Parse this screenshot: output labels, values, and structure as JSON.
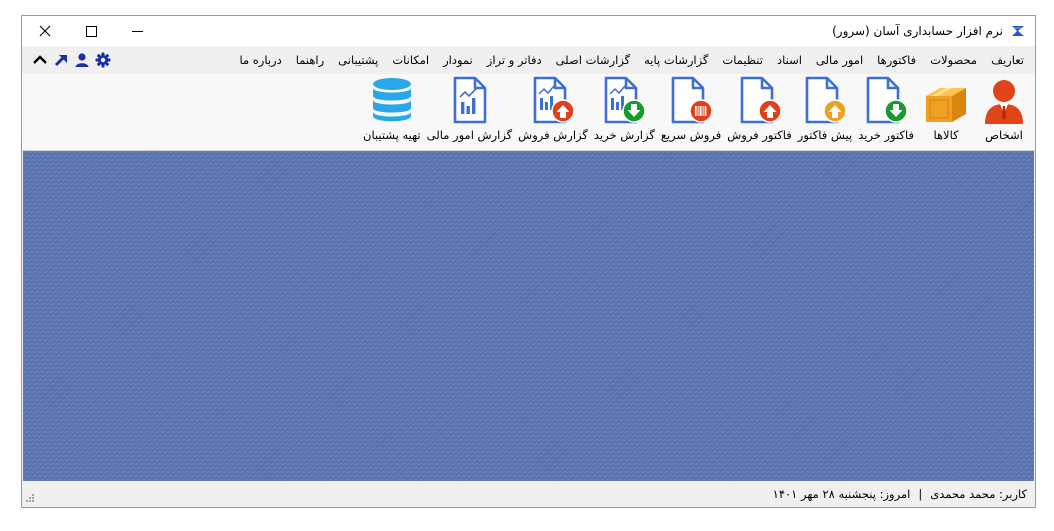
{
  "window": {
    "title": "نرم افزار حسابداری آسان (سرور)",
    "controls": {
      "close": "✕",
      "maximize": "☐",
      "minimize": "—"
    }
  },
  "menu": {
    "items": [
      "تعاریف",
      "محصولات",
      "فاکتورها",
      "امور مالی",
      "اسناد",
      "تنظیمات",
      "گزارشات پایه",
      "گزارشات اصلی",
      "دفاتر و تراز",
      "نمودار",
      "امکانات",
      "پشتیبانی",
      "راهنما",
      "درباره ما"
    ],
    "icons": [
      "gear-icon",
      "user-icon",
      "arrow-up-right-icon",
      "chevron-up-icon"
    ]
  },
  "toolbar": {
    "items": [
      {
        "label": "اشخاص",
        "icon": "person-icon"
      },
      {
        "label": "کالاها",
        "icon": "box-icon"
      },
      {
        "label": "فاکتور خرید",
        "icon": "purchase-invoice-icon"
      },
      {
        "label": "پیش فاکتور",
        "icon": "proforma-invoice-icon"
      },
      {
        "label": "فاکتور فروش",
        "icon": "sales-invoice-icon"
      },
      {
        "label": "فروش سریع",
        "icon": "quick-sale-icon"
      },
      {
        "label": "گزارش خرید",
        "icon": "purchase-report-icon"
      },
      {
        "label": "گزارش فروش",
        "icon": "sales-report-icon"
      },
      {
        "label": "گزارش امور مالی",
        "icon": "financial-report-icon"
      },
      {
        "label": "تهیه پشتیبان",
        "icon": "backup-database-icon"
      }
    ]
  },
  "status": {
    "today": "امروز: پنجشنبه ۲۸ مهر ۱۴۰۱",
    "separator": "|",
    "user": "کاربر: محمد محمدی"
  },
  "colors": {
    "accent_blue": "#3f6fd0",
    "icon_dark_blue": "#1b2fa8",
    "orange": "#f0a020",
    "red": "#e0401a",
    "green": "#1a9a2a",
    "workspace": "#5a76b4"
  }
}
